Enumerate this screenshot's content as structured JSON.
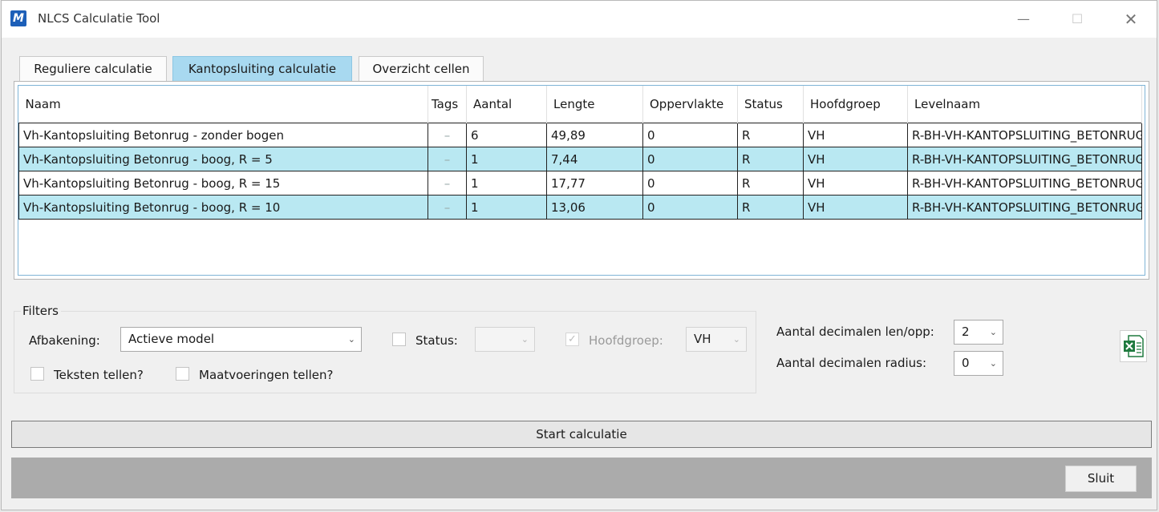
{
  "window": {
    "title": "NLCS Calculatie Tool",
    "app_icon_letter": "M",
    "min_glyph": "—",
    "max_glyph": "☐",
    "close_glyph": "✕"
  },
  "tabs": [
    {
      "label": "Reguliere calculatie",
      "active": false
    },
    {
      "label": "Kantopsluiting calculatie",
      "active": true
    },
    {
      "label": "Overzicht cellen",
      "active": false
    }
  ],
  "grid": {
    "columns": [
      "Naam",
      "Tags",
      "Aantal",
      "Lengte",
      "Oppervlakte",
      "Status",
      "Hoofdgroep",
      "Levelnaam"
    ],
    "rows": [
      {
        "naam": "Vh-Kantopsluiting Betonrug - zonder bogen",
        "tags": "–",
        "aantal": "6",
        "lengte": "49,89",
        "oppervlakte": "0",
        "status": "R",
        "hoofdgroep": "VH",
        "levelnaam": "R-BH-VH-KANTOPSLUITING_BETONRUG"
      },
      {
        "naam": "Vh-Kantopsluiting Betonrug - boog, R = 5",
        "tags": "–",
        "aantal": "1",
        "lengte": "7,44",
        "oppervlakte": "0",
        "status": "R",
        "hoofdgroep": "VH",
        "levelnaam": "R-BH-VH-KANTOPSLUITING_BETONRUG"
      },
      {
        "naam": "Vh-Kantopsluiting Betonrug - boog, R = 15",
        "tags": "–",
        "aantal": "1",
        "lengte": "17,77",
        "oppervlakte": "0",
        "status": "R",
        "hoofdgroep": "VH",
        "levelnaam": "R-BH-VH-KANTOPSLUITING_BETONRUG"
      },
      {
        "naam": "Vh-Kantopsluiting Betonrug - boog, R = 10",
        "tags": "–",
        "aantal": "1",
        "lengte": "13,06",
        "oppervlakte": "0",
        "status": "R",
        "hoofdgroep": "VH",
        "levelnaam": "R-BH-VH-KANTOPSLUITING_BETONRUG"
      }
    ],
    "alt_row_color": "#b9e8f2"
  },
  "filters": {
    "legend": "Filters",
    "afbakening_label": "Afbakening:",
    "afbakening_value": "Actieve model",
    "status_label": "Status:",
    "status_checked": false,
    "status_value": "",
    "hoofdgroep_label": "Hoofdgroep:",
    "hoofdgroep_checked": true,
    "hoofdgroep_value": "VH",
    "teksten_label": "Teksten tellen?",
    "teksten_checked": false,
    "maatvoeringen_label": "Maatvoeringen tellen?",
    "maatvoeringen_checked": false
  },
  "decimals": {
    "len_opp_label": "Aantal decimalen len/opp:",
    "len_opp_value": "2",
    "radius_label": "Aantal decimalen radius:",
    "radius_value": "0"
  },
  "actions": {
    "start_label": "Start calculatie",
    "close_label": "Sluit",
    "export_icon": "excel-export-icon"
  },
  "colors": {
    "active_tab": "#a8d9f0",
    "app_icon": "#1d5fb8",
    "excel_green": "#1f7a3f"
  }
}
